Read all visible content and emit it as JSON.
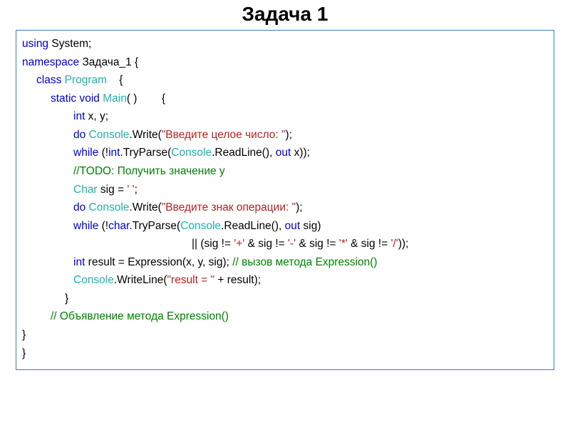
{
  "title": "Задача 1",
  "code": {
    "l1a": "using",
    "l1b": " System;",
    "l2a": "namespace",
    "l2b": " Задача_1 {",
    "l3a": "class",
    "l3b": " Program",
    "l3c": "    {",
    "l4a": "static",
    "l4b": " void",
    "l4c": " Main",
    "l4d": "( )        {",
    "l5a": "int",
    "l5b": " x, y;",
    "l6a": "do",
    "l6b": " Console",
    "l6c": ".Write(",
    "l6d": "\"Введите целое число: \"",
    "l6e": ");",
    "l7a": "while",
    "l7b": " (!",
    "l7c": "int",
    "l7d": ".TryParse(",
    "l7e": "Console",
    "l7f": ".ReadLine(), ",
    "l7g": "out",
    "l7h": " x));",
    "l8": "//TODO: Получить значение y",
    "l9a": "Char",
    "l9b": " sig = ",
    "l9c": "' '",
    "l9d": ";",
    "l10a": "do",
    "l10b": " Console",
    "l10c": ".Write(",
    "l10d": "\"Введите знак операции: \"",
    "l10e": ");",
    "l11a": "while",
    "l11b": " (!",
    "l11c": "char",
    "l11d": ".TryParse(",
    "l11e": "Console",
    "l11f": ".ReadLine(), ",
    "l11g": "out",
    "l11h": " sig)",
    "l12a": "|| (sig != ",
    "l12b": "'+'",
    "l12c": " & sig != ",
    "l12d": "'-'",
    "l12e": " & sig != ",
    "l12f": "'*'",
    "l12g": " & sig != ",
    "l12h": "'/'",
    "l12i": "));",
    "l13a": "int",
    "l13b": " result = Expression(x, y, sig); ",
    "l13c": "// вызов метода Expression()",
    "l14a": "Console",
    "l14b": ".WriteLine(",
    "l14c": "\"result = \"",
    "l14d": " + result);",
    "l15": "}",
    "l16": "// Объявление метода Expression()",
    "l17": "}",
    "l18": "}"
  }
}
